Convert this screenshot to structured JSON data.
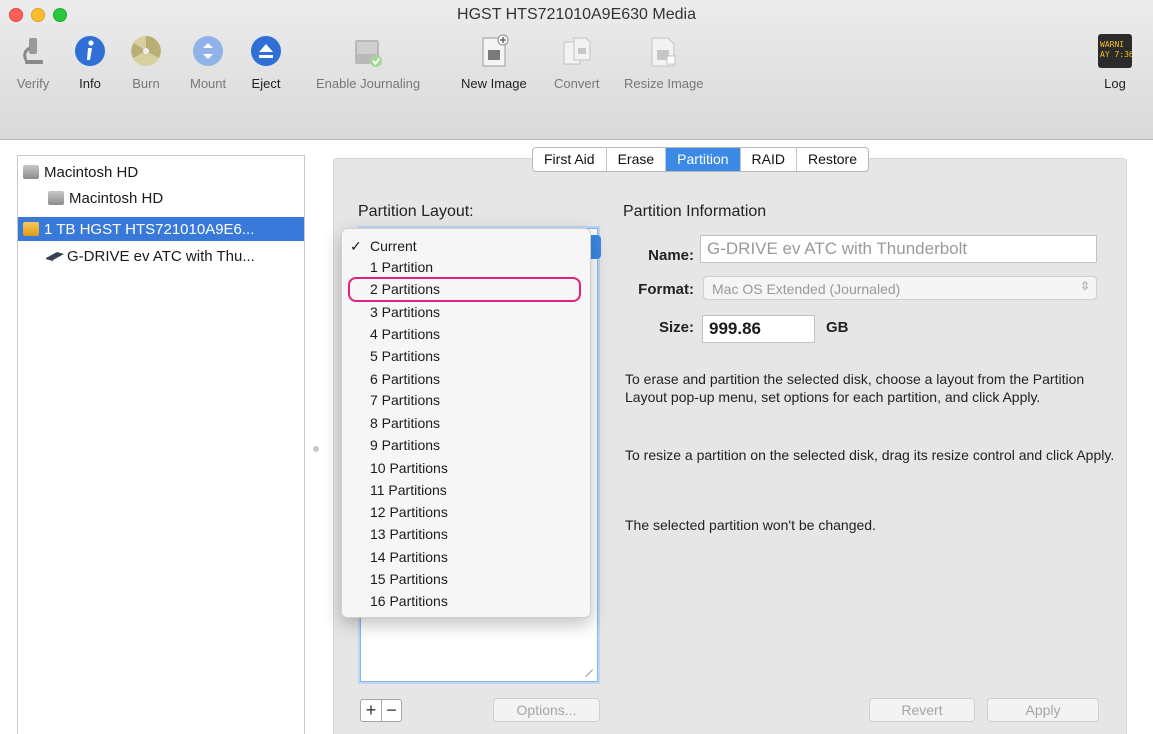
{
  "window": {
    "title": "HGST HTS721010A9E630 Media",
    "traffic_lights": [
      "#fd5f57",
      "#fdbc2e",
      "#28c840"
    ]
  },
  "toolbar": {
    "items": [
      {
        "label": "Verify",
        "icon": "microscope-icon",
        "enabled": false
      },
      {
        "label": "Info",
        "icon": "info-icon",
        "enabled": true
      },
      {
        "label": "Burn",
        "icon": "burn-icon",
        "enabled": false
      },
      {
        "label": "Mount",
        "icon": "mount-icon",
        "enabled": false
      },
      {
        "label": "Eject",
        "icon": "eject-icon",
        "enabled": true
      },
      {
        "label": "Enable Journaling",
        "icon": "journaling-icon",
        "enabled": false
      },
      {
        "label": "New Image",
        "icon": "new-image-icon",
        "enabled": true
      },
      {
        "label": "Convert",
        "icon": "convert-icon",
        "enabled": false
      },
      {
        "label": "Resize Image",
        "icon": "resize-image-icon",
        "enabled": false
      }
    ],
    "log": {
      "label": "Log",
      "icon_text": "WARNI\nAY 7:36"
    }
  },
  "sidebar": {
    "items": [
      {
        "label": "Macintosh HD",
        "level": 0,
        "selected": false
      },
      {
        "label": "Macintosh HD",
        "level": 1,
        "selected": false
      },
      {
        "label": "1 TB HGST HTS721010A9E6...",
        "level": 0,
        "selected": true
      },
      {
        "label": "G-DRIVE ev ATC with Thu...",
        "level": 1,
        "selected": false
      }
    ]
  },
  "tabs": [
    {
      "label": "First Aid",
      "active": false
    },
    {
      "label": "Erase",
      "active": false
    },
    {
      "label": "Partition",
      "active": true
    },
    {
      "label": "RAID",
      "active": false
    },
    {
      "label": "Restore",
      "active": false
    }
  ],
  "partition": {
    "layout_title": "Partition Layout:",
    "info_title": "Partition Information",
    "name_label": "Name:",
    "name_value": "G-DRIVE ev ATC with Thunderbolt",
    "format_label": "Format:",
    "format_value": "Mac OS Extended (Journaled)",
    "size_label": "Size:",
    "size_value": "999.86",
    "size_unit": "GB",
    "help1": "To erase and partition the selected disk, choose a layout from the Partition Layout pop-up menu, set options for each partition, and click Apply.",
    "help2": "To resize a partition on the selected disk, drag its resize control and click Apply.",
    "help3": "The selected partition won't be changed.",
    "options_label": "Options...",
    "revert_label": "Revert",
    "apply_label": "Apply",
    "plus": "+",
    "minus": "−"
  },
  "menu": {
    "items": [
      {
        "label": "Current",
        "checked": true
      },
      {
        "label": "1 Partition",
        "checked": false
      },
      {
        "label": "2 Partitions",
        "checked": false,
        "highlighted": true
      },
      {
        "label": "3 Partitions",
        "checked": false
      },
      {
        "label": "4 Partitions",
        "checked": false
      },
      {
        "label": "5 Partitions",
        "checked": false
      },
      {
        "label": "6 Partitions",
        "checked": false
      },
      {
        "label": "7 Partitions",
        "checked": false
      },
      {
        "label": "8 Partitions",
        "checked": false
      },
      {
        "label": "9 Partitions",
        "checked": false
      },
      {
        "label": "10 Partitions",
        "checked": false
      },
      {
        "label": "11 Partitions",
        "checked": false
      },
      {
        "label": "12 Partitions",
        "checked": false
      },
      {
        "label": "13 Partitions",
        "checked": false
      },
      {
        "label": "14 Partitions",
        "checked": false
      },
      {
        "label": "15 Partitions",
        "checked": false
      },
      {
        "label": "16 Partitions",
        "checked": false
      }
    ]
  },
  "colors": {
    "selection": "#3879d9",
    "tab_active": "#3c8ae6",
    "annotation": "#e0217f"
  }
}
